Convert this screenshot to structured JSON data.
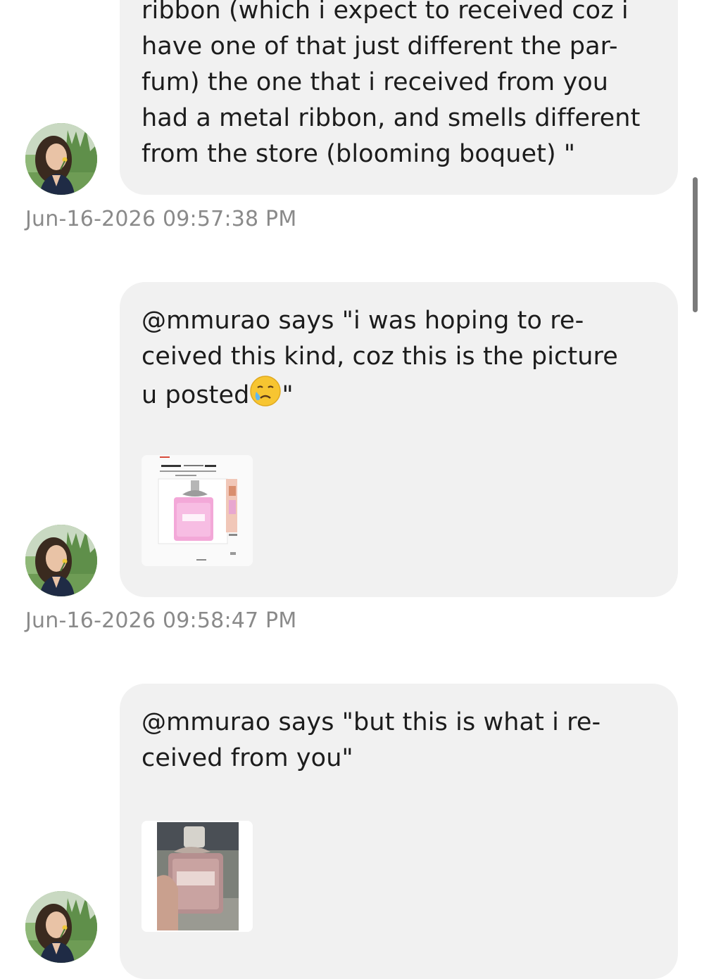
{
  "messages": [
    {
      "lines": [
        "ribbon (which i expect to received coz i",
        "have one of that just different the par-",
        "fum) the one that i received from you",
        "had a metal ribbon, and smells different",
        "from the store (blooming boquet) \""
      ],
      "timestamp": "Jun-16-2026 09:57:38 PM"
    },
    {
      "lines": [
        "@mmurao says \"i was hoping to re-",
        "ceived this kind, coz this is the picture",
        "u posted",
        "\""
      ],
      "emoji": "crying-face-emoji",
      "attachment": "listing-screenshot-image",
      "timestamp": "Jun-16-2026 09:58:47 PM"
    },
    {
      "lines": [
        "@mmurao says \"but this is what i re-",
        "ceived from you\""
      ],
      "attachment": "received-perfume-photo"
    }
  ],
  "colors": {
    "bubble": "#f1f1f1",
    "timestamp": "#8a8a8a",
    "text": "#1c1c1c"
  }
}
